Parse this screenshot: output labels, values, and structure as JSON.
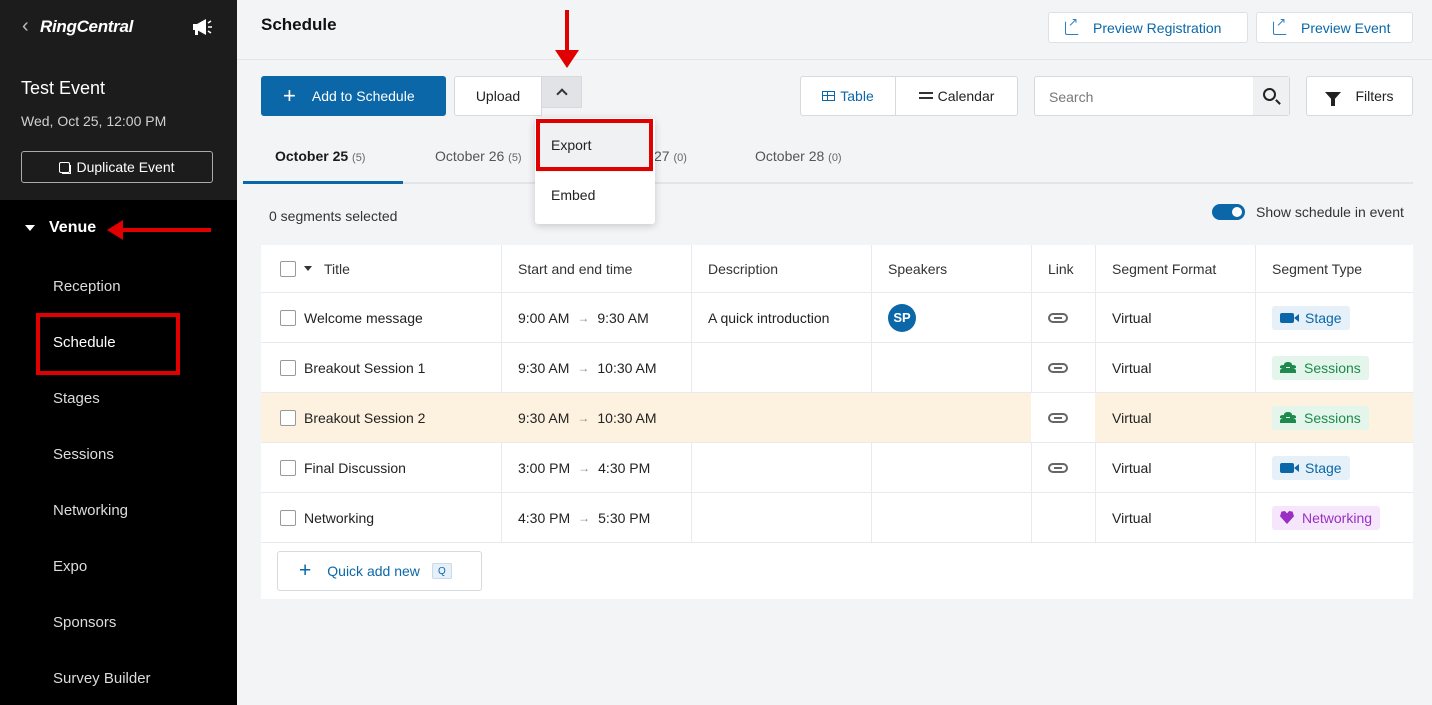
{
  "sidebar": {
    "logo": "RingCentral",
    "event_title": "Test Event",
    "event_date": "Wed, Oct 25, 12:00 PM",
    "duplicate_label": "Duplicate Event",
    "section_label": "Venue",
    "items": [
      {
        "label": "Reception"
      },
      {
        "label": "Schedule"
      },
      {
        "label": "Stages"
      },
      {
        "label": "Sessions"
      },
      {
        "label": "Networking"
      },
      {
        "label": "Expo"
      },
      {
        "label": "Sponsors"
      },
      {
        "label": "Survey Builder"
      }
    ]
  },
  "header": {
    "title": "Schedule",
    "preview_registration": "Preview Registration",
    "preview_event": "Preview Event"
  },
  "toolbar": {
    "add_label": "Add to Schedule",
    "upload_label": "Upload",
    "view_table": "Table",
    "view_calendar": "Calendar",
    "search_placeholder": "Search",
    "filters_label": "Filters"
  },
  "dropdown": {
    "items": [
      {
        "label": "Export"
      },
      {
        "label": "Embed"
      }
    ]
  },
  "tabs": [
    {
      "label": "October 25",
      "count": "(5)"
    },
    {
      "label": "October 26",
      "count": "(5)"
    },
    {
      "label": "27",
      "count": "(0)"
    },
    {
      "label": "October 28",
      "count": "(0)"
    }
  ],
  "subbar": {
    "selected_text": "0 segments selected",
    "show_schedule_label": "Show schedule in event"
  },
  "table": {
    "headers": {
      "title": "Title",
      "time": "Start and end time",
      "description": "Description",
      "speakers": "Speakers",
      "link": "Link",
      "format": "Segment Format",
      "type": "Segment Type"
    },
    "rows": [
      {
        "title": "Welcome message",
        "start": "9:00 AM",
        "end": "9:30 AM",
        "description": "A quick introduction",
        "speaker": "SP",
        "format": "Virtual",
        "type": "Stage"
      },
      {
        "title": "Breakout Session 1",
        "start": "9:30 AM",
        "end": "10:30 AM",
        "description": "",
        "speaker": "",
        "format": "Virtual",
        "type": "Sessions"
      },
      {
        "title": "Breakout Session 2",
        "start": "9:30 AM",
        "end": "10:30 AM",
        "description": "",
        "speaker": "",
        "format": "Virtual",
        "type": "Sessions"
      },
      {
        "title": "Final Discussion",
        "start": "3:00 PM",
        "end": "4:30 PM",
        "description": "",
        "speaker": "",
        "format": "Virtual",
        "type": "Stage"
      },
      {
        "title": "Networking",
        "start": "4:30 PM",
        "end": "5:30 PM",
        "description": "",
        "speaker": "",
        "format": "Virtual",
        "type": "Networking"
      }
    ],
    "quick_add_label": "Quick add new",
    "quick_add_key": "Q"
  },
  "colors": {
    "accent": "#0b67a8",
    "sidebar_bg": "#000000",
    "highlight_row": "#fdf2e0",
    "annotation_red": "#e00000"
  }
}
